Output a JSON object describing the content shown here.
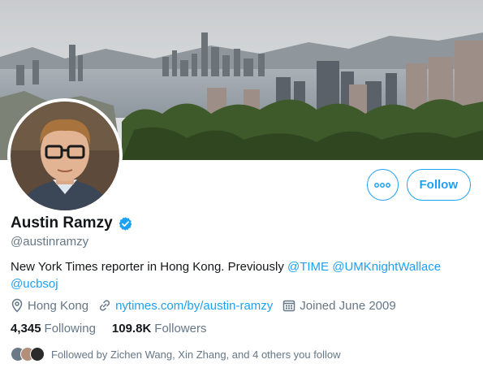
{
  "profile": {
    "name": "Austin Ramzy",
    "handle": "@austinramzy",
    "verified": true
  },
  "bio": {
    "text_line1": "New York Times reporter in Hong Kong. Previously ",
    "mention_time": "@TIME",
    "mention_umkw": "@UMKnightWallace",
    "mention_ucbsoj": "@ucbsoj"
  },
  "meta": {
    "location": "Hong Kong",
    "website": "nytimes.com/by/austin-ramzy",
    "joined": "Joined June 2009",
    "location_icon": "location-pin-icon",
    "link_icon": "link-icon",
    "calendar_icon": "calendar-icon"
  },
  "counts": {
    "following_value": "4,345",
    "following_label": "Following",
    "followers_value": "109.8K",
    "followers_label": "Followers"
  },
  "followed_by": {
    "text": "Followed by Zichen Wang, Xin Zhang, and 4 others you follow"
  },
  "actions": {
    "follow_label": "Follow",
    "more_icon": "more-icon"
  },
  "colors": {
    "accent": "#1da1f2",
    "secondary_text": "#657786",
    "primary_text": "#14171a"
  }
}
